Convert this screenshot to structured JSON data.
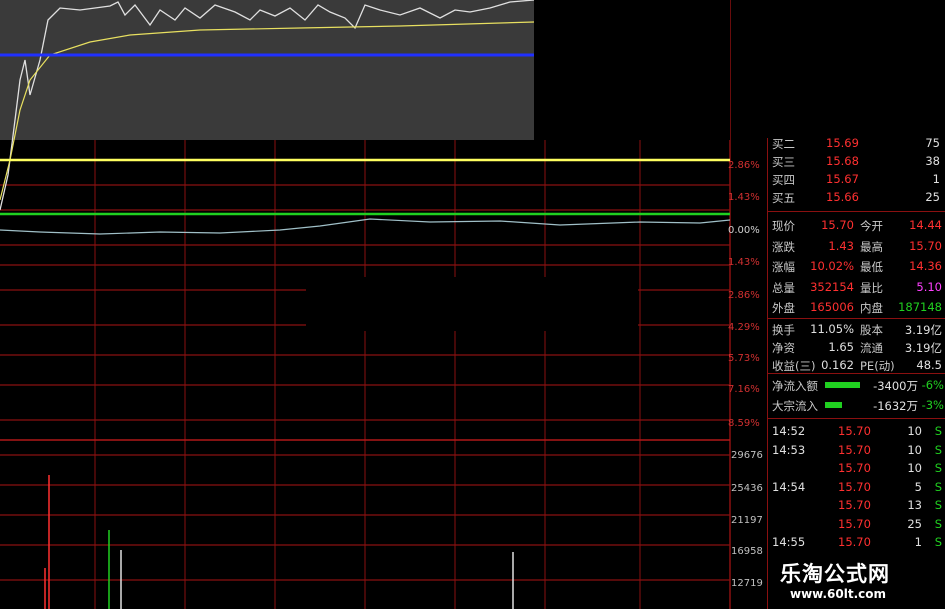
{
  "pct_labels": [
    "2.86%",
    "1.43%",
    "0.00%",
    "1.43%",
    "2.86%",
    "4.29%",
    "5.73%",
    "7.16%",
    "8.59%"
  ],
  "vol_labels": [
    "29676",
    "25436",
    "21197",
    "16958",
    "12719"
  ],
  "quote": {
    "bids": [
      {
        "label": "买二",
        "price": "15.69",
        "vol": "75"
      },
      {
        "label": "买三",
        "price": "15.68",
        "vol": "38"
      },
      {
        "label": "买四",
        "price": "15.67",
        "vol": "1"
      },
      {
        "label": "买五",
        "price": "15.66",
        "vol": "25"
      }
    ],
    "stats": [
      {
        "l1": "现价",
        "v1": "15.70",
        "l2": "今开",
        "v2": "14.44"
      },
      {
        "l1": "涨跌",
        "v1": "1.43",
        "l2": "最高",
        "v2": "15.70"
      },
      {
        "l1": "涨幅",
        "v1": "10.02%",
        "l2": "最低",
        "v2": "14.36"
      },
      {
        "l1": "总量",
        "v1": "352154",
        "l2": "量比",
        "v2": "5.10"
      },
      {
        "l1": "外盘",
        "v1": "165006",
        "l2": "内盘",
        "v2": "187148"
      }
    ],
    "fund": [
      {
        "l1": "换手",
        "v1": "11.05%",
        "l2": "股本",
        "v2": "3.19亿"
      },
      {
        "l1": "净资",
        "v1": "1.65",
        "l2": "流通",
        "v2": "3.19亿"
      },
      {
        "l1": "收益(三)",
        "v1": "0.162",
        "l2": "PE(动)",
        "v2": "48.5"
      }
    ],
    "flow": [
      {
        "label": "净流入额",
        "amount": "-3400万",
        "pct": "-6%",
        "bar": 0.75
      },
      {
        "label": "大宗流入",
        "amount": "-1632万",
        "pct": "-3%",
        "bar": 0.36
      }
    ],
    "ticks": [
      {
        "time": "14:52",
        "price": "15.70",
        "vol": "10",
        "side": "S"
      },
      {
        "time": "14:53",
        "price": "15.70",
        "vol": "10",
        "side": "S"
      },
      {
        "time": "",
        "price": "15.70",
        "vol": "10",
        "side": "S"
      },
      {
        "time": "14:54",
        "price": "15.70",
        "vol": "5",
        "side": "S"
      },
      {
        "time": "",
        "price": "15.70",
        "vol": "13",
        "side": "S"
      },
      {
        "time": "",
        "price": "15.70",
        "vol": "25",
        "side": "S"
      },
      {
        "time": "14:55",
        "price": "15.70",
        "vol": "1",
        "side": "S"
      }
    ]
  },
  "watermark": {
    "title": "乐淘公式网",
    "url": "www.60lt.com"
  },
  "colors": {
    "grid": "#8a1010",
    "price": "#e0e0e0",
    "avg": "#e8e060",
    "ref_yellow": "#ffff60",
    "ref_green": "#20d020",
    "ref_blue": "#2030ff",
    "up": "#ff3030",
    "down": "#20d020"
  }
}
